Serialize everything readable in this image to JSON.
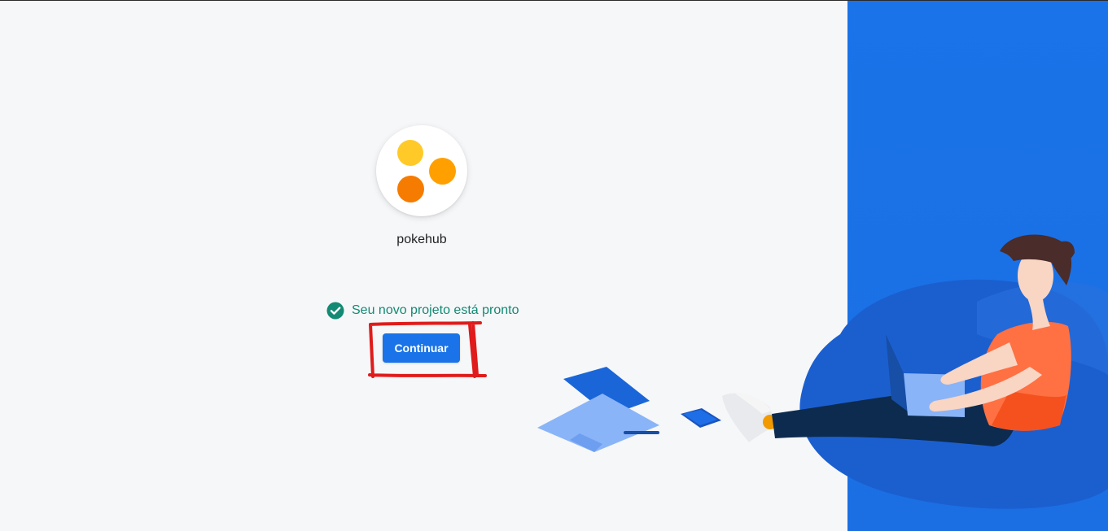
{
  "project": {
    "name": "pokehub",
    "logo_colors": [
      "#ffca28",
      "#ffa000",
      "#f57c00"
    ]
  },
  "status": {
    "text": "Seu novo projeto está pronto",
    "icon": "check-circle-icon",
    "color": "#138a73"
  },
  "actions": {
    "continue_label": "Continuar"
  },
  "theme": {
    "accent": "#1a73e8",
    "background": "#f6f7f9",
    "annotation": "#e01b1b"
  }
}
